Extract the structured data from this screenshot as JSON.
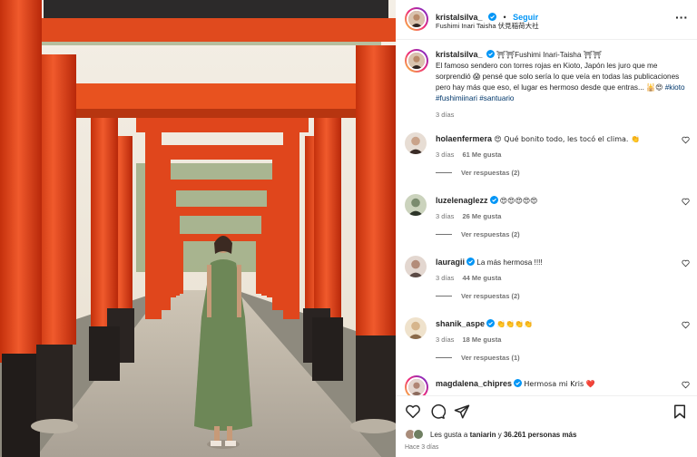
{
  "post_author": {
    "username": "kristalsilva_",
    "follow_label": "Seguir",
    "location": "Fushimi Inari Taisha 伏見稲荷大社",
    "more_label": "···"
  },
  "caption": {
    "username": "kristalsilva_",
    "emoji_lead": "⛩⛩",
    "title": "Fushimi Inari-Taisha",
    "emoji_tail": "⛩⛩",
    "body": "El famoso sendero con torres rojas en Kioto, Japón les juro que me sorprendió",
    "body2": "pensé que solo sería lo que veía en todas las publicaciones pero hay más que eso, el lugar es hermoso desde que entras...",
    "emoji_end": "🕌😍",
    "hashtags": "#kioto #fushimiinari #santuario",
    "time": "3 días"
  },
  "comments": [
    {
      "username": "holaenfermera",
      "text": "😍 Qué bonito todo, les tocó el clima. 👏",
      "time": "3 días",
      "likes": "61 Me gusta",
      "replies": "Ver respuestas (2)",
      "avatar_color": "#c9a38a"
    },
    {
      "username": "luzelenaglezz",
      "text": "😍😍😍😍😍",
      "time": "3 días",
      "likes": "26 Me gusta",
      "replies": "Ver respuestas (2)",
      "avatar_color": "#7a8b6e"
    },
    {
      "username": "lauragii",
      "text": "La más hermosa !!!!",
      "time": "3 días",
      "likes": "44 Me gusta",
      "replies": "Ver respuestas (2)",
      "avatar_color": "#5a4a45"
    },
    {
      "username": "shanik_aspe",
      "text": "👏👏👏👏",
      "time": "3 días",
      "likes": "18 Me gusta",
      "replies": "Ver respuestas (1)",
      "avatar_color": "#d6b58c"
    },
    {
      "username": "magdalena_chipres",
      "text": "Hermosa mi Kris ❤️",
      "time": "",
      "likes": "",
      "replies": "",
      "avatar_color": "#8b6a5c"
    }
  ],
  "footer": {
    "likes_prefix": "Les gusta a ",
    "likes_user": "taniarin",
    "likes_mid": " y ",
    "likes_count": "36.261 personas más",
    "time": "Hace 3 días"
  },
  "icons": [
    "verified-icon",
    "more-icon",
    "heart-icon",
    "comment-icon",
    "share-icon",
    "bookmark-icon"
  ],
  "colors": {
    "accent": "#0095f6",
    "verified": "#0095f6",
    "torii": "#e2481f",
    "heart_red": "#ed4956"
  }
}
